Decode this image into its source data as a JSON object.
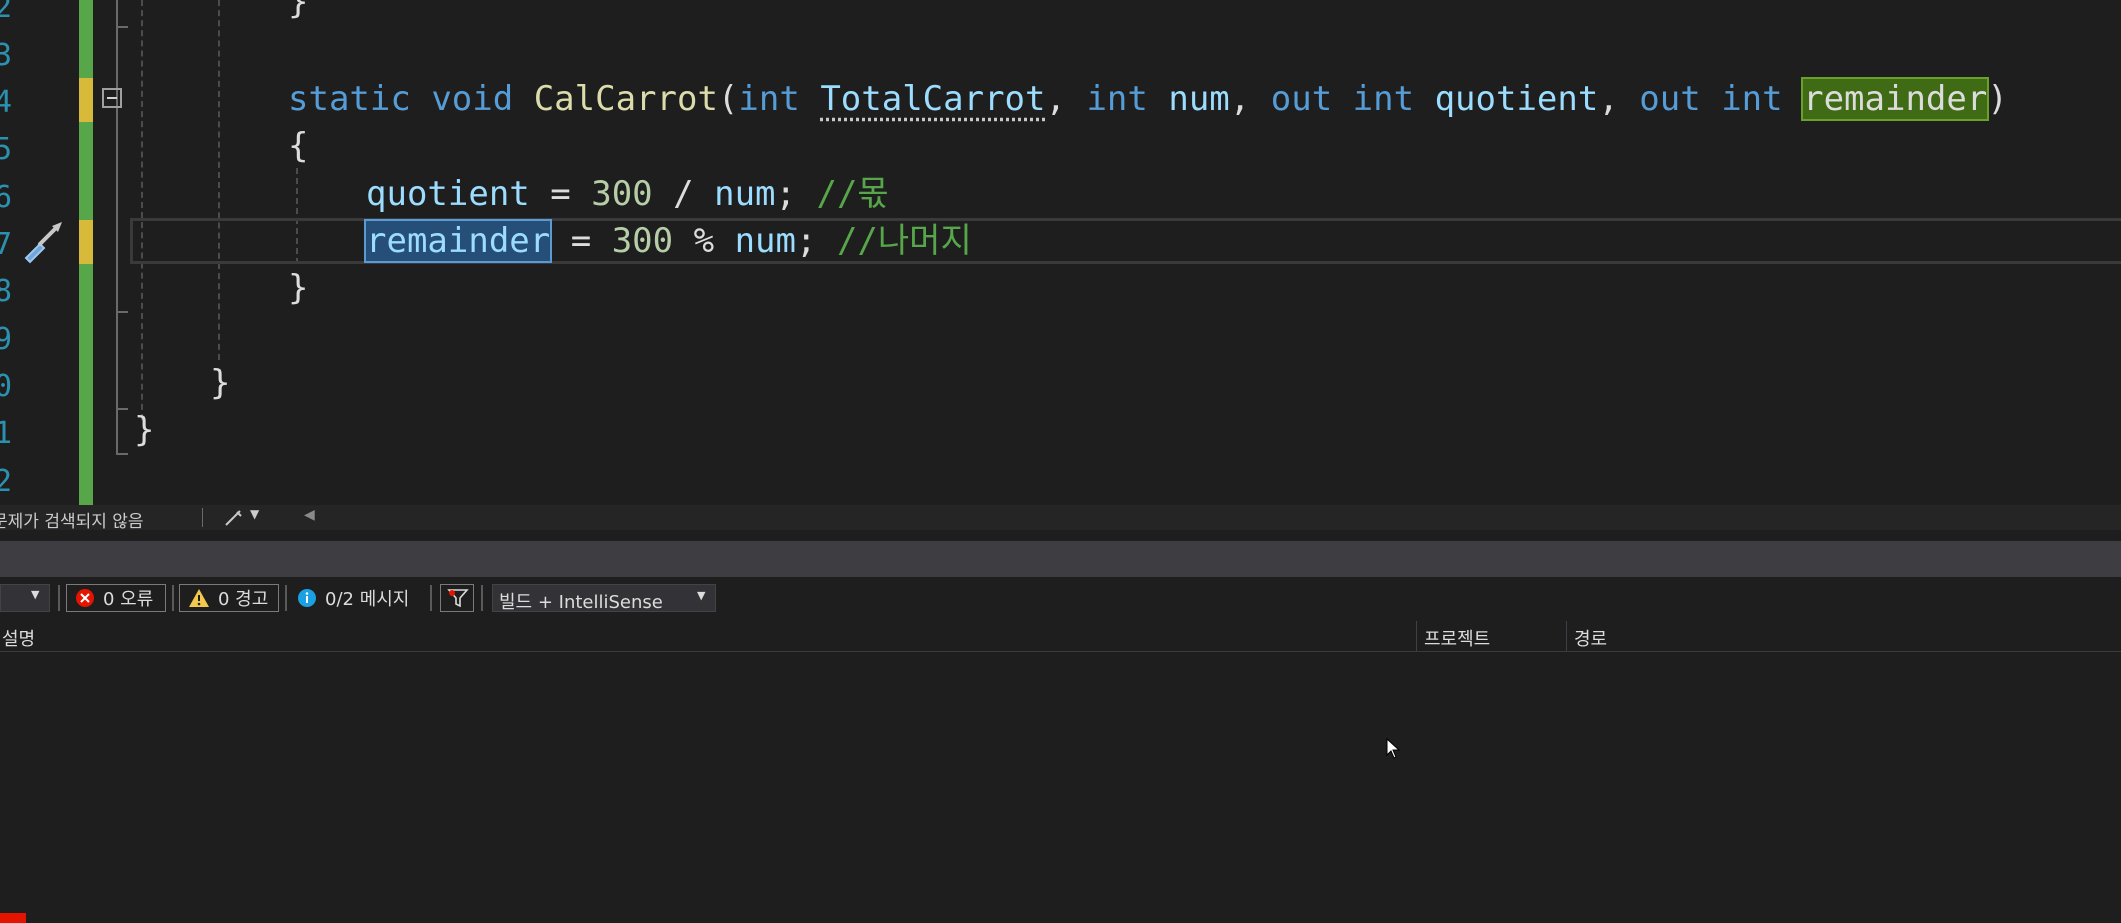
{
  "editor": {
    "line_numbers": [
      "2",
      "3",
      "4",
      "5",
      "6",
      "7",
      "8",
      "9",
      "0",
      "1",
      "2"
    ],
    "lines": {
      "l2": "}",
      "sig": {
        "kw_static": "static",
        "kw_void": "void",
        "method": "CalCarrot",
        "open": "(",
        "kw_int1": "int",
        "p1": "TotalCarrot",
        "c1": ",",
        "kw_int2": "int",
        "p2": "num",
        "c2": ",",
        "kw_out1": "out",
        "kw_int3": "int",
        "p3": "quotient",
        "c3": ",",
        "kw_out2": "out",
        "kw_int4": "int",
        "p4": "remainder",
        "close": ")"
      },
      "open_brace": "{",
      "q_line": {
        "var": "quotient",
        "op": "=",
        "num": "300",
        "div": "/",
        "var2": "num",
        "semi": ";",
        "comment": "//몫"
      },
      "r_line": {
        "var": "remainder",
        "op": "=",
        "num": "300",
        "mod": "%",
        "var2": "num",
        "semi": ";",
        "comment": "//나머지"
      },
      "close_brace_method": "}",
      "close_brace_class": "}",
      "close_brace_ns": "}"
    }
  },
  "status_bar": {
    "issues_text": "문제가 검색되지 않음"
  },
  "error_list": {
    "errors": "0 오류",
    "warnings": "0 경고",
    "messages": "0/2 메시지",
    "scope": "빌드 + IntelliSense",
    "columns": {
      "description": "설명",
      "project": "프로젝트",
      "path": "경로"
    }
  },
  "icons": [
    "collapse-icon",
    "screwdriver-icon",
    "dropdown-arrow-icon",
    "scroll-left-icon",
    "error-icon",
    "warning-icon",
    "info-icon",
    "filter-icon",
    "mouse-cursor-icon"
  ],
  "colors": {
    "keyword": "#569cd6",
    "method": "#dcdcaa",
    "variable": "#9cdcfe",
    "number": "#b5cea8",
    "comment": "#57a64a",
    "line_number": "#2b91af",
    "saved_change": "#57a64a",
    "unsaved_change": "#d7ba3a"
  }
}
